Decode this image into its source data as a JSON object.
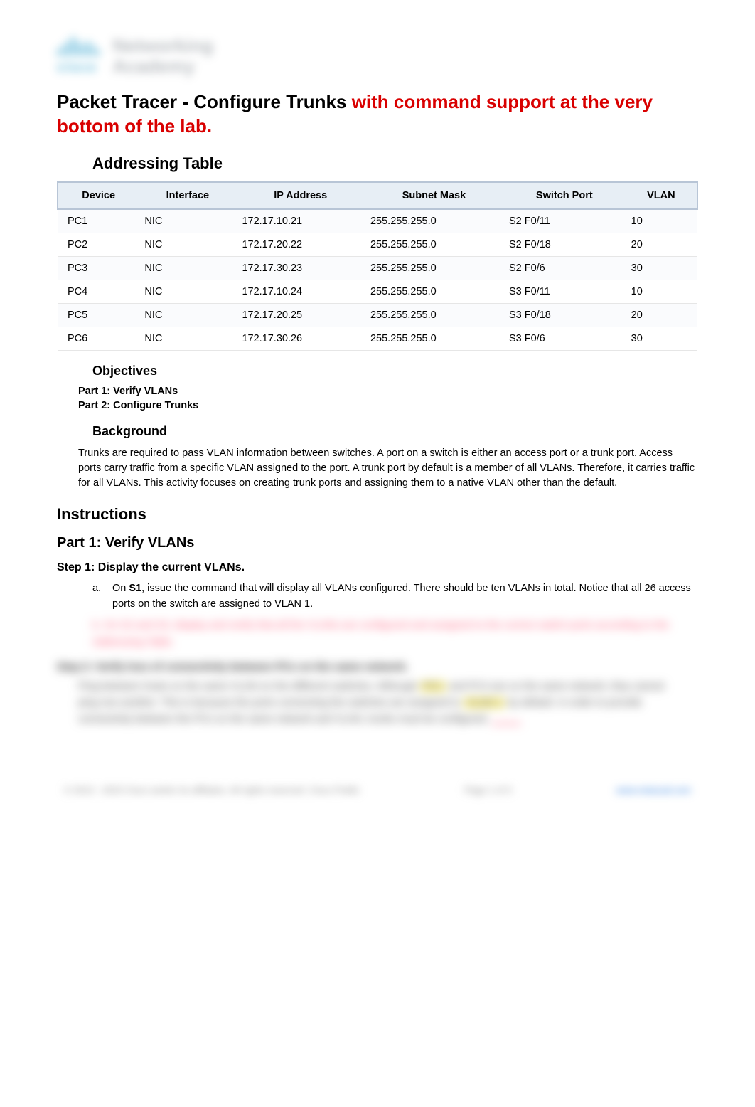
{
  "logo": {
    "brand": "cisco",
    "line1": "Networking",
    "line2": "Academy"
  },
  "title": {
    "black": "Packet Tracer - Configure Trunks ",
    "red": "with command support at the very bottom of the lab."
  },
  "addressing": {
    "heading": "Addressing Table",
    "columns": [
      "Device",
      "Interface",
      "IP Address",
      "Subnet Mask",
      "Switch Port",
      "VLAN"
    ],
    "rows": [
      {
        "device": "PC1",
        "interface": "NIC",
        "ip": "172.17.10.21",
        "mask": "255.255.255.0",
        "port": "S2 F0/11",
        "vlan": "10"
      },
      {
        "device": "PC2",
        "interface": "NIC",
        "ip": "172.17.20.22",
        "mask": "255.255.255.0",
        "port": "S2 F0/18",
        "vlan": "20"
      },
      {
        "device": "PC3",
        "interface": "NIC",
        "ip": "172.17.30.23",
        "mask": "255.255.255.0",
        "port": "S2 F0/6",
        "vlan": "30"
      },
      {
        "device": "PC4",
        "interface": "NIC",
        "ip": "172.17.10.24",
        "mask": "255.255.255.0",
        "port": "S3 F0/11",
        "vlan": "10"
      },
      {
        "device": "PC5",
        "interface": "NIC",
        "ip": "172.17.20.25",
        "mask": "255.255.255.0",
        "port": "S3 F0/18",
        "vlan": "20"
      },
      {
        "device": "PC6",
        "interface": "NIC",
        "ip": "172.17.30.26",
        "mask": "255.255.255.0",
        "port": "S3 F0/6",
        "vlan": "30"
      }
    ]
  },
  "objectives": {
    "heading": "Objectives",
    "items": [
      "Part 1: Verify VLANs",
      "Part 2: Configure Trunks"
    ]
  },
  "background": {
    "heading": "Background",
    "text": "Trunks are required to pass VLAN information between switches. A port on a switch is either an access port or a trunk port. Access ports carry traffic from a specific VLAN assigned to the port. A trunk port by default is a member of all VLANs. Therefore, it carries traffic for all VLANs. This activity focuses on creating trunk ports and assigning them to a native VLAN other than the default."
  },
  "instructions": {
    "heading": "Instructions",
    "part1": {
      "heading": "Part 1: Verify VLANs",
      "step1": {
        "heading": "Step 1: Display the current VLANs.",
        "a_letter": "a.",
        "a_text": "On S1, issue the command that will display all VLANs configured. There should be ten VLANs in total. Notice that all 26 access ports on the switch are assigned to VLAN 1.",
        "b_letter": "b.",
        "b_blurred": "On S2 and S3, display and verify that all the VLANs are configured and assigned to the correct switch ports according to the Addressing Table."
      },
      "step2": {
        "heading_blurred": "Step 2: Verify loss of connectivity between PCs on the same network.",
        "para_blurred_1": "Ping between hosts on the same VLAN on the different switches. Although",
        "para_blurred_hl1": "PC1",
        "para_blurred_2": "and PC4 are on the same network, they cannot ping one another. This is because the ports connecting the switches are assigned to",
        "para_blurred_hl2": "VLAN 1",
        "para_blurred_3": "by default. In order to provide connectivity between the PCs on the same network and VLAN, trunks must be configured."
      }
    }
  },
  "footer": {
    "left": "© 2013 - 2023 Cisco and/or its affiliates. All rights reserved. Cisco Public",
    "center": "Page 1 of 3",
    "right": "www.netacad.com"
  }
}
